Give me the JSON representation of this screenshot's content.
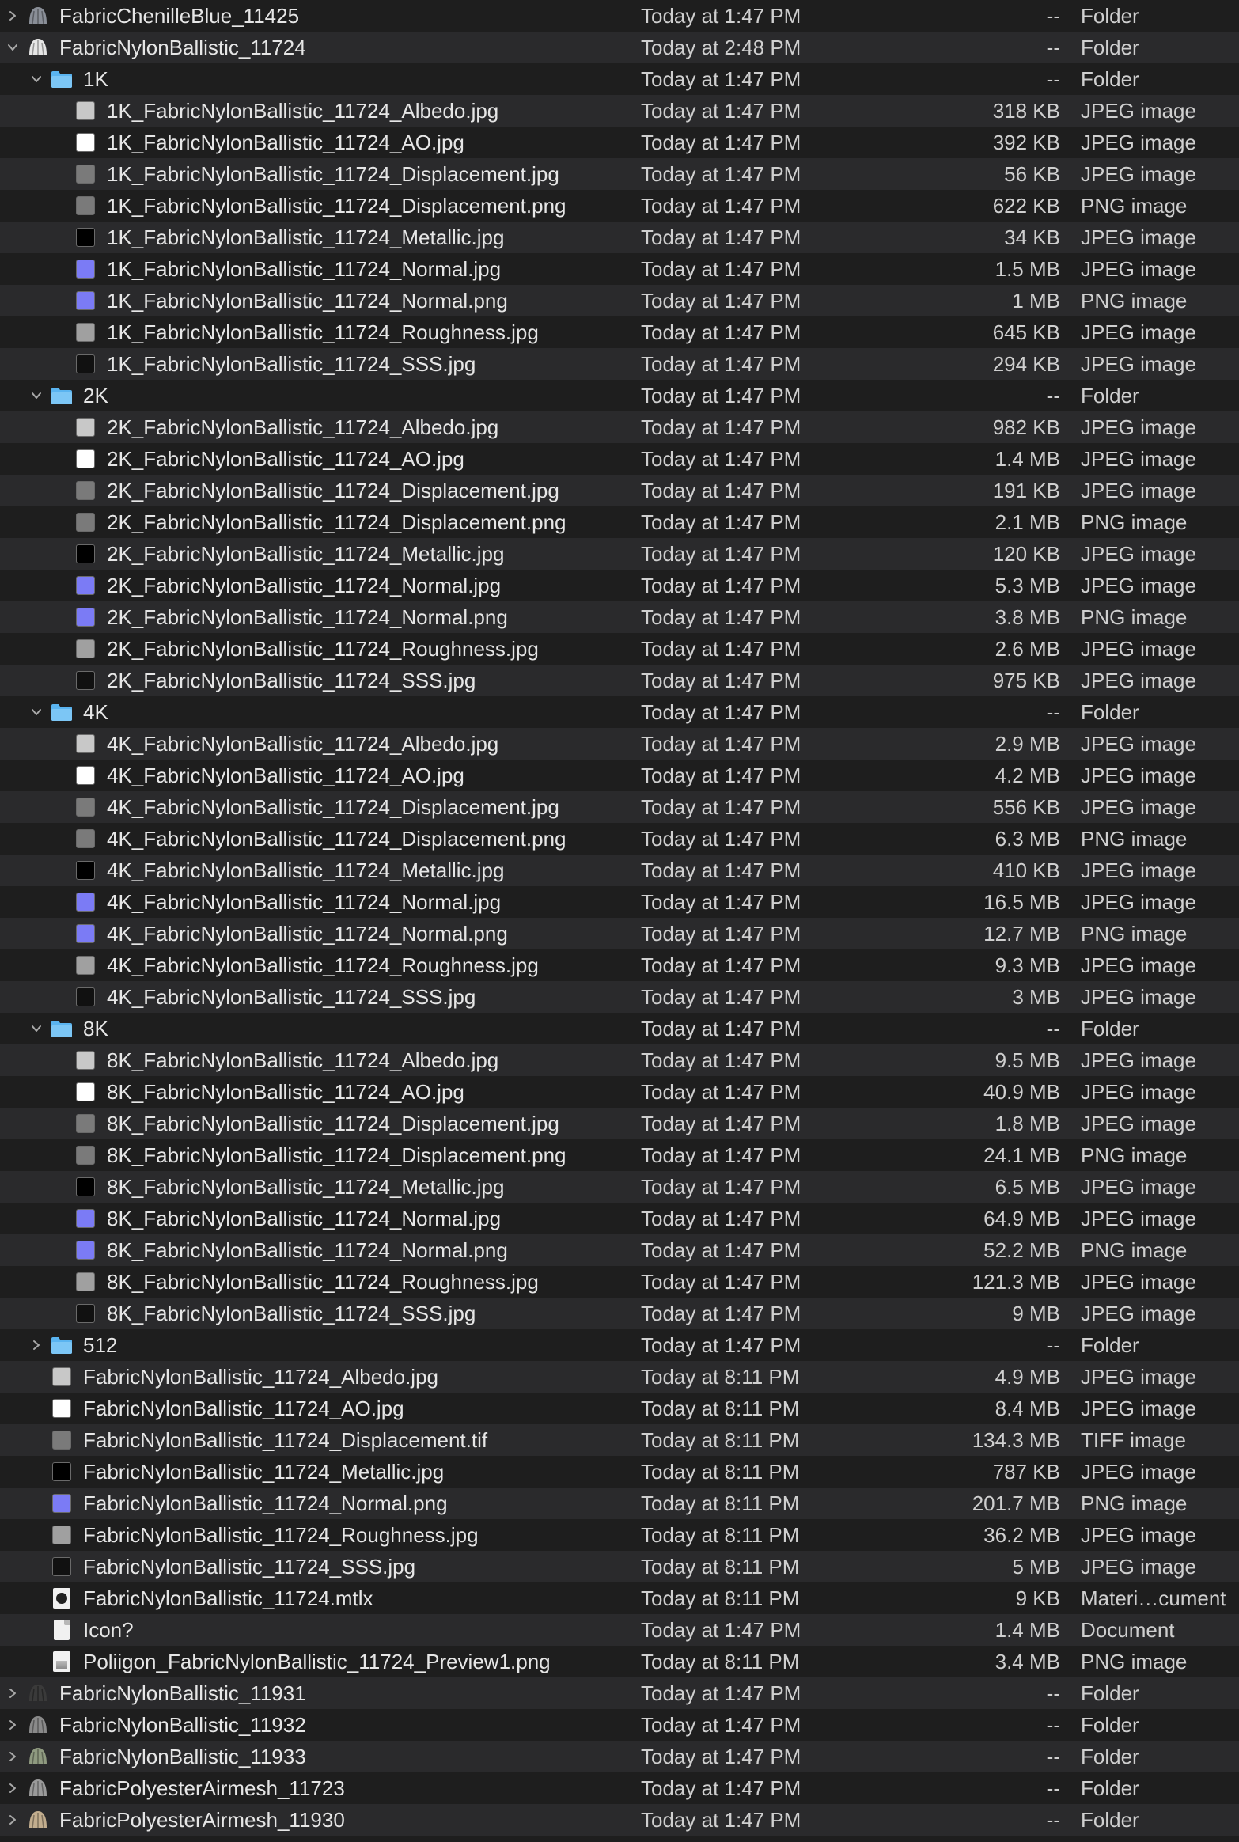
{
  "rows": [
    {
      "level": 0,
      "disclosure": "closed",
      "icon": "cloth-icon",
      "icon_color": "#8a8f98",
      "name": "FabricChenilleBlue_11425",
      "date": "Today at 1:47 PM",
      "size": "--",
      "kind": "Folder"
    },
    {
      "level": 0,
      "disclosure": "open",
      "icon": "cloth-icon",
      "icon_color": "#e6e6e6",
      "name": "FabricNylonBallistic_11724",
      "date": "Today at 2:48 PM",
      "size": "--",
      "kind": "Folder"
    },
    {
      "level": 1,
      "disclosure": "open",
      "icon": "folder-icon",
      "icon_color": "#5ab4f0",
      "name": "1K",
      "date": "Today at 1:47 PM",
      "size": "--",
      "kind": "Folder"
    },
    {
      "level": 2,
      "disclosure": "none",
      "icon": "swatch-icon",
      "icon_color": "#c8c8c8",
      "name": "1K_FabricNylonBallistic_11724_Albedo.jpg",
      "date": "Today at 1:47 PM",
      "size": "318 KB",
      "kind": "JPEG image"
    },
    {
      "level": 2,
      "disclosure": "none",
      "icon": "swatch-icon",
      "icon_color": "#ffffff",
      "name": "1K_FabricNylonBallistic_11724_AO.jpg",
      "date": "Today at 1:47 PM",
      "size": "392 KB",
      "kind": "JPEG image"
    },
    {
      "level": 2,
      "disclosure": "none",
      "icon": "swatch-icon",
      "icon_color": "#7a7a7a",
      "name": "1K_FabricNylonBallistic_11724_Displacement.jpg",
      "date": "Today at 1:47 PM",
      "size": "56 KB",
      "kind": "JPEG image"
    },
    {
      "level": 2,
      "disclosure": "none",
      "icon": "swatch-icon",
      "icon_color": "#7a7a7a",
      "name": "1K_FabricNylonBallistic_11724_Displacement.png",
      "date": "Today at 1:47 PM",
      "size": "622 KB",
      "kind": "PNG image"
    },
    {
      "level": 2,
      "disclosure": "none",
      "icon": "swatch-icon",
      "icon_color": "#000000",
      "name": "1K_FabricNylonBallistic_11724_Metallic.jpg",
      "date": "Today at 1:47 PM",
      "size": "34 KB",
      "kind": "JPEG image"
    },
    {
      "level": 2,
      "disclosure": "none",
      "icon": "swatch-icon",
      "icon_color": "#7b7bf5",
      "name": "1K_FabricNylonBallistic_11724_Normal.jpg",
      "date": "Today at 1:47 PM",
      "size": "1.5 MB",
      "kind": "JPEG image"
    },
    {
      "level": 2,
      "disclosure": "none",
      "icon": "swatch-icon",
      "icon_color": "#7b7bf5",
      "name": "1K_FabricNylonBallistic_11724_Normal.png",
      "date": "Today at 1:47 PM",
      "size": "1 MB",
      "kind": "PNG image"
    },
    {
      "level": 2,
      "disclosure": "none",
      "icon": "swatch-icon",
      "icon_color": "#a0a0a0",
      "name": "1K_FabricNylonBallistic_11724_Roughness.jpg",
      "date": "Today at 1:47 PM",
      "size": "645 KB",
      "kind": "JPEG image"
    },
    {
      "level": 2,
      "disclosure": "none",
      "icon": "swatch-icon",
      "icon_color": "#111111",
      "name": "1K_FabricNylonBallistic_11724_SSS.jpg",
      "date": "Today at 1:47 PM",
      "size": "294 KB",
      "kind": "JPEG image"
    },
    {
      "level": 1,
      "disclosure": "open",
      "icon": "folder-icon",
      "icon_color": "#5ab4f0",
      "name": "2K",
      "date": "Today at 1:47 PM",
      "size": "--",
      "kind": "Folder"
    },
    {
      "level": 2,
      "disclosure": "none",
      "icon": "swatch-icon",
      "icon_color": "#c8c8c8",
      "name": "2K_FabricNylonBallistic_11724_Albedo.jpg",
      "date": "Today at 1:47 PM",
      "size": "982 KB",
      "kind": "JPEG image"
    },
    {
      "level": 2,
      "disclosure": "none",
      "icon": "swatch-icon",
      "icon_color": "#ffffff",
      "name": "2K_FabricNylonBallistic_11724_AO.jpg",
      "date": "Today at 1:47 PM",
      "size": "1.4 MB",
      "kind": "JPEG image"
    },
    {
      "level": 2,
      "disclosure": "none",
      "icon": "swatch-icon",
      "icon_color": "#7a7a7a",
      "name": "2K_FabricNylonBallistic_11724_Displacement.jpg",
      "date": "Today at 1:47 PM",
      "size": "191 KB",
      "kind": "JPEG image"
    },
    {
      "level": 2,
      "disclosure": "none",
      "icon": "swatch-icon",
      "icon_color": "#7a7a7a",
      "name": "2K_FabricNylonBallistic_11724_Displacement.png",
      "date": "Today at 1:47 PM",
      "size": "2.1 MB",
      "kind": "PNG image"
    },
    {
      "level": 2,
      "disclosure": "none",
      "icon": "swatch-icon",
      "icon_color": "#000000",
      "name": "2K_FabricNylonBallistic_11724_Metallic.jpg",
      "date": "Today at 1:47 PM",
      "size": "120 KB",
      "kind": "JPEG image"
    },
    {
      "level": 2,
      "disclosure": "none",
      "icon": "swatch-icon",
      "icon_color": "#7b7bf5",
      "name": "2K_FabricNylonBallistic_11724_Normal.jpg",
      "date": "Today at 1:47 PM",
      "size": "5.3 MB",
      "kind": "JPEG image"
    },
    {
      "level": 2,
      "disclosure": "none",
      "icon": "swatch-icon",
      "icon_color": "#7b7bf5",
      "name": "2K_FabricNylonBallistic_11724_Normal.png",
      "date": "Today at 1:47 PM",
      "size": "3.8 MB",
      "kind": "PNG image"
    },
    {
      "level": 2,
      "disclosure": "none",
      "icon": "swatch-icon",
      "icon_color": "#a0a0a0",
      "name": "2K_FabricNylonBallistic_11724_Roughness.jpg",
      "date": "Today at 1:47 PM",
      "size": "2.6 MB",
      "kind": "JPEG image"
    },
    {
      "level": 2,
      "disclosure": "none",
      "icon": "swatch-icon",
      "icon_color": "#111111",
      "name": "2K_FabricNylonBallistic_11724_SSS.jpg",
      "date": "Today at 1:47 PM",
      "size": "975 KB",
      "kind": "JPEG image"
    },
    {
      "level": 1,
      "disclosure": "open",
      "icon": "folder-icon",
      "icon_color": "#5ab4f0",
      "name": "4K",
      "date": "Today at 1:47 PM",
      "size": "--",
      "kind": "Folder"
    },
    {
      "level": 2,
      "disclosure": "none",
      "icon": "swatch-icon",
      "icon_color": "#c8c8c8",
      "name": "4K_FabricNylonBallistic_11724_Albedo.jpg",
      "date": "Today at 1:47 PM",
      "size": "2.9 MB",
      "kind": "JPEG image"
    },
    {
      "level": 2,
      "disclosure": "none",
      "icon": "swatch-icon",
      "icon_color": "#ffffff",
      "name": "4K_FabricNylonBallistic_11724_AO.jpg",
      "date": "Today at 1:47 PM",
      "size": "4.2 MB",
      "kind": "JPEG image"
    },
    {
      "level": 2,
      "disclosure": "none",
      "icon": "swatch-icon",
      "icon_color": "#7a7a7a",
      "name": "4K_FabricNylonBallistic_11724_Displacement.jpg",
      "date": "Today at 1:47 PM",
      "size": "556 KB",
      "kind": "JPEG image"
    },
    {
      "level": 2,
      "disclosure": "none",
      "icon": "swatch-icon",
      "icon_color": "#7a7a7a",
      "name": "4K_FabricNylonBallistic_11724_Displacement.png",
      "date": "Today at 1:47 PM",
      "size": "6.3 MB",
      "kind": "PNG image"
    },
    {
      "level": 2,
      "disclosure": "none",
      "icon": "swatch-icon",
      "icon_color": "#000000",
      "name": "4K_FabricNylonBallistic_11724_Metallic.jpg",
      "date": "Today at 1:47 PM",
      "size": "410 KB",
      "kind": "JPEG image"
    },
    {
      "level": 2,
      "disclosure": "none",
      "icon": "swatch-icon",
      "icon_color": "#7b7bf5",
      "name": "4K_FabricNylonBallistic_11724_Normal.jpg",
      "date": "Today at 1:47 PM",
      "size": "16.5 MB",
      "kind": "JPEG image"
    },
    {
      "level": 2,
      "disclosure": "none",
      "icon": "swatch-icon",
      "icon_color": "#7b7bf5",
      "name": "4K_FabricNylonBallistic_11724_Normal.png",
      "date": "Today at 1:47 PM",
      "size": "12.7 MB",
      "kind": "PNG image"
    },
    {
      "level": 2,
      "disclosure": "none",
      "icon": "swatch-icon",
      "icon_color": "#a0a0a0",
      "name": "4K_FabricNylonBallistic_11724_Roughness.jpg",
      "date": "Today at 1:47 PM",
      "size": "9.3 MB",
      "kind": "JPEG image"
    },
    {
      "level": 2,
      "disclosure": "none",
      "icon": "swatch-icon",
      "icon_color": "#111111",
      "name": "4K_FabricNylonBallistic_11724_SSS.jpg",
      "date": "Today at 1:47 PM",
      "size": "3 MB",
      "kind": "JPEG image"
    },
    {
      "level": 1,
      "disclosure": "open",
      "icon": "folder-icon",
      "icon_color": "#5ab4f0",
      "name": "8K",
      "date": "Today at 1:47 PM",
      "size": "--",
      "kind": "Folder"
    },
    {
      "level": 2,
      "disclosure": "none",
      "icon": "swatch-icon",
      "icon_color": "#c8c8c8",
      "name": "8K_FabricNylonBallistic_11724_Albedo.jpg",
      "date": "Today at 1:47 PM",
      "size": "9.5 MB",
      "kind": "JPEG image"
    },
    {
      "level": 2,
      "disclosure": "none",
      "icon": "swatch-icon",
      "icon_color": "#ffffff",
      "name": "8K_FabricNylonBallistic_11724_AO.jpg",
      "date": "Today at 1:47 PM",
      "size": "40.9 MB",
      "kind": "JPEG image"
    },
    {
      "level": 2,
      "disclosure": "none",
      "icon": "swatch-icon",
      "icon_color": "#7a7a7a",
      "name": "8K_FabricNylonBallistic_11724_Displacement.jpg",
      "date": "Today at 1:47 PM",
      "size": "1.8 MB",
      "kind": "JPEG image"
    },
    {
      "level": 2,
      "disclosure": "none",
      "icon": "swatch-icon",
      "icon_color": "#7a7a7a",
      "name": "8K_FabricNylonBallistic_11724_Displacement.png",
      "date": "Today at 1:47 PM",
      "size": "24.1 MB",
      "kind": "PNG image"
    },
    {
      "level": 2,
      "disclosure": "none",
      "icon": "swatch-icon",
      "icon_color": "#000000",
      "name": "8K_FabricNylonBallistic_11724_Metallic.jpg",
      "date": "Today at 1:47 PM",
      "size": "6.5 MB",
      "kind": "JPEG image"
    },
    {
      "level": 2,
      "disclosure": "none",
      "icon": "swatch-icon",
      "icon_color": "#7b7bf5",
      "name": "8K_FabricNylonBallistic_11724_Normal.jpg",
      "date": "Today at 1:47 PM",
      "size": "64.9 MB",
      "kind": "JPEG image"
    },
    {
      "level": 2,
      "disclosure": "none",
      "icon": "swatch-icon",
      "icon_color": "#7b7bf5",
      "name": "8K_FabricNylonBallistic_11724_Normal.png",
      "date": "Today at 1:47 PM",
      "size": "52.2 MB",
      "kind": "PNG image"
    },
    {
      "level": 2,
      "disclosure": "none",
      "icon": "swatch-icon",
      "icon_color": "#a0a0a0",
      "name": "8K_FabricNylonBallistic_11724_Roughness.jpg",
      "date": "Today at 1:47 PM",
      "size": "121.3 MB",
      "kind": "JPEG image"
    },
    {
      "level": 2,
      "disclosure": "none",
      "icon": "swatch-icon",
      "icon_color": "#111111",
      "name": "8K_FabricNylonBallistic_11724_SSS.jpg",
      "date": "Today at 1:47 PM",
      "size": "9 MB",
      "kind": "JPEG image"
    },
    {
      "level": 1,
      "disclosure": "closed",
      "icon": "folder-icon",
      "icon_color": "#5ab4f0",
      "name": "512",
      "date": "Today at 1:47 PM",
      "size": "--",
      "kind": "Folder"
    },
    {
      "level": 1,
      "disclosure": "none",
      "icon": "swatch-icon",
      "icon_color": "#c8c8c8",
      "name": "FabricNylonBallistic_11724_Albedo.jpg",
      "date": "Today at 8:11 PM",
      "size": "4.9 MB",
      "kind": "JPEG image"
    },
    {
      "level": 1,
      "disclosure": "none",
      "icon": "swatch-icon",
      "icon_color": "#ffffff",
      "name": "FabricNylonBallistic_11724_AO.jpg",
      "date": "Today at 8:11 PM",
      "size": "8.4 MB",
      "kind": "JPEG image"
    },
    {
      "level": 1,
      "disclosure": "none",
      "icon": "swatch-icon",
      "icon_color": "#7a7a7a",
      "name": "FabricNylonBallistic_11724_Displacement.tif",
      "date": "Today at 8:11 PM",
      "size": "134.3 MB",
      "kind": "TIFF image"
    },
    {
      "level": 1,
      "disclosure": "none",
      "icon": "swatch-icon",
      "icon_color": "#000000",
      "name": "FabricNylonBallistic_11724_Metallic.jpg",
      "date": "Today at 8:11 PM",
      "size": "787 KB",
      "kind": "JPEG image"
    },
    {
      "level": 1,
      "disclosure": "none",
      "icon": "swatch-icon",
      "icon_color": "#7b7bf5",
      "name": "FabricNylonBallistic_11724_Normal.png",
      "date": "Today at 8:11 PM",
      "size": "201.7 MB",
      "kind": "PNG image"
    },
    {
      "level": 1,
      "disclosure": "none",
      "icon": "swatch-icon",
      "icon_color": "#a0a0a0",
      "name": "FabricNylonBallistic_11724_Roughness.jpg",
      "date": "Today at 8:11 PM",
      "size": "36.2 MB",
      "kind": "JPEG image"
    },
    {
      "level": 1,
      "disclosure": "none",
      "icon": "swatch-icon",
      "icon_color": "#111111",
      "name": "FabricNylonBallistic_11724_SSS.jpg",
      "date": "Today at 8:11 PM",
      "size": "5 MB",
      "kind": "JPEG image"
    },
    {
      "level": 1,
      "disclosure": "none",
      "icon": "mtlx-file-icon",
      "icon_color": "#f1f1f1",
      "name": "FabricNylonBallistic_11724.mtlx",
      "date": "Today at 8:11 PM",
      "size": "9 KB",
      "kind": "Materi…cument"
    },
    {
      "level": 1,
      "disclosure": "none",
      "icon": "document-icon",
      "icon_color": "#f1f1f1",
      "name": "Icon?",
      "date": "Today at 1:47 PM",
      "size": "1.4 MB",
      "kind": "Document"
    },
    {
      "level": 1,
      "disclosure": "none",
      "icon": "image-preview-icon",
      "icon_color": "#f1f1f1",
      "name": "Poliigon_FabricNylonBallistic_11724_Preview1.png",
      "date": "Today at 8:11 PM",
      "size": "3.4 MB",
      "kind": "PNG image"
    },
    {
      "level": 0,
      "disclosure": "closed",
      "icon": "cloth-icon",
      "icon_color": "#3a3a3a",
      "name": "FabricNylonBallistic_11931",
      "date": "Today at 1:47 PM",
      "size": "--",
      "kind": "Folder"
    },
    {
      "level": 0,
      "disclosure": "closed",
      "icon": "cloth-icon",
      "icon_color": "#8a8a8a",
      "name": "FabricNylonBallistic_11932",
      "date": "Today at 1:47 PM",
      "size": "--",
      "kind": "Folder"
    },
    {
      "level": 0,
      "disclosure": "closed",
      "icon": "cloth-icon",
      "icon_color": "#8f9a80",
      "name": "FabricNylonBallistic_11933",
      "date": "Today at 1:47 PM",
      "size": "--",
      "kind": "Folder"
    },
    {
      "level": 0,
      "disclosure": "closed",
      "icon": "cloth-icon",
      "icon_color": "#9a9a9a",
      "name": "FabricPolyesterAirmesh_11723",
      "date": "Today at 1:47 PM",
      "size": "--",
      "kind": "Folder"
    },
    {
      "level": 0,
      "disclosure": "closed",
      "icon": "cloth-icon",
      "icon_color": "#c2ad8e",
      "name": "FabricPolyesterAirmesh_11930",
      "date": "Today at 1:47 PM",
      "size": "--",
      "kind": "Folder"
    }
  ]
}
